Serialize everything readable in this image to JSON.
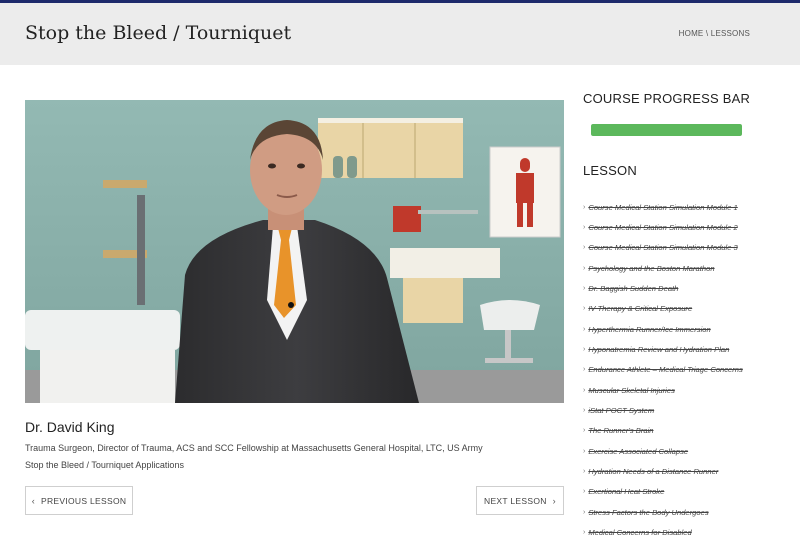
{
  "header": {
    "title": "Stop the Bleed / Tourniquet",
    "breadcrumb": {
      "home": "HOME",
      "separator": "\\",
      "lessons": "LESSONS"
    }
  },
  "presenter": {
    "name": "Dr. David King",
    "title": "Trauma Surgeon, Director of Trauma, ACS and SCC Fellowship at Massachusetts General Hospital, LTC, US Army",
    "topic": "Stop the Bleed / Tourniquet Applications"
  },
  "navigation": {
    "previous_label": "PREVIOUS LESSON",
    "next_label": "NEXT LESSON",
    "prev_icon": "chevron-left-icon",
    "next_icon": "chevron-right-icon"
  },
  "sidebar": {
    "progress_heading": "COURSE PROGRESS BAR",
    "progress_percent": 100,
    "progress_color": "#5cb85c",
    "lesson_heading": "LESSON",
    "lessons": [
      "Course Medical Station Simulation Module 1",
      "Course Medical Station Simulation Module 2",
      "Course Medical Station Simulation Module 3",
      "Psychology and the Boston Marathon",
      "Dr. Baggish Sudden Death",
      "IV Therapy & Critical Exposure",
      "Hyperthermia Runner/Ice Immersion",
      "Hyponatremia Review and Hydration Plan",
      "Endurance Athlete – Medical Triage Concerns",
      "Muscular Skeletal Injuries",
      "iStat POCT System",
      "The Runner's Brain",
      "Exercise Associated Collapse",
      "Hydration Needs of a Distance Runner",
      "Exertional Heat Stroke",
      "Stress Factors the Body Undergoes",
      "Medical Concerns for Disabled"
    ]
  },
  "colors": {
    "top_accent": "#1d2a6b",
    "header_bg": "#ececec"
  }
}
